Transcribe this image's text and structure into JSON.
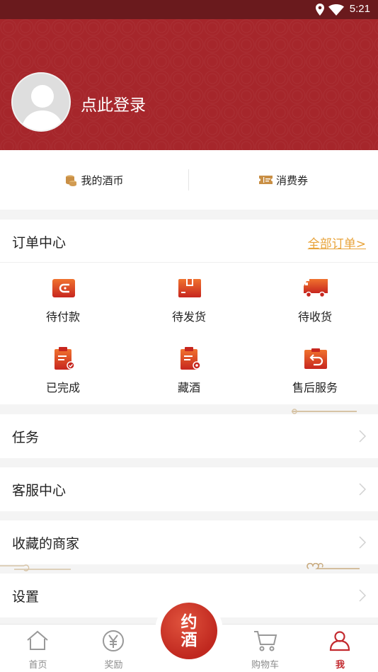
{
  "status_bar": {
    "time": "5:21"
  },
  "header": {
    "login_text": "点此登录"
  },
  "assets": {
    "coins_label": "我的酒币",
    "coupons_label": "消费券"
  },
  "orders": {
    "title": "订单中心",
    "all_link": "全部订单>",
    "items": [
      {
        "label": "待付款",
        "icon": "wallet-icon"
      },
      {
        "label": "待发货",
        "icon": "package-icon"
      },
      {
        "label": "待收货",
        "icon": "truck-icon"
      },
      {
        "label": "已完成",
        "icon": "clipboard-check-icon"
      },
      {
        "label": "藏酒",
        "icon": "clipboard-wine-icon"
      },
      {
        "label": "售后服务",
        "icon": "return-icon"
      }
    ]
  },
  "menu": {
    "tasks": "任务",
    "service": "客服中心",
    "favorites": "收藏的商家",
    "settings": "设置"
  },
  "tabbar": {
    "center": [
      "约",
      "酒"
    ],
    "items": [
      {
        "label": "首页",
        "icon": "home-icon"
      },
      {
        "label": "奖励",
        "icon": "yen-icon"
      },
      {
        "label": "购物车",
        "icon": "cart-icon"
      },
      {
        "label": "我",
        "icon": "user-icon",
        "active": true
      }
    ]
  },
  "colors": {
    "brand_red": "#a6262b",
    "accent_orange": "#e8a33a",
    "active_tab": "#c32a2f"
  }
}
